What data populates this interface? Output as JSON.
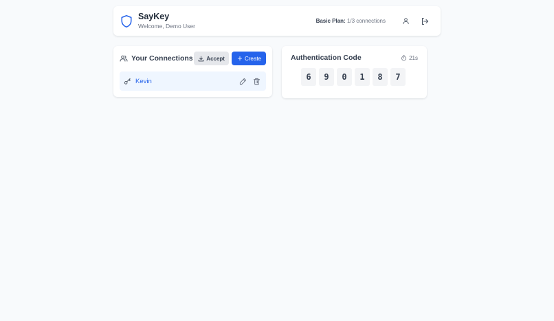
{
  "header": {
    "app_name": "SayKey",
    "welcome": "Welcome, Demo User",
    "plan_label": "Basic Plan:",
    "plan_value": "1/3 connections",
    "icons": {
      "brand": "shield-icon",
      "profile": "user-icon",
      "logout": "logout-icon"
    }
  },
  "connections": {
    "title": "Your Connections",
    "accept_label": "Accept",
    "create_label": "Create",
    "items": [
      {
        "name": "Kevin",
        "icon": "key-icon"
      }
    ]
  },
  "auth": {
    "title": "Authentication Code",
    "timer": "21s",
    "digits": [
      "6",
      "9",
      "0",
      "1",
      "8",
      "7"
    ]
  },
  "colors": {
    "accent": "#2563eb",
    "background": "#f8fafc",
    "item_bg": "#eff6ff"
  }
}
